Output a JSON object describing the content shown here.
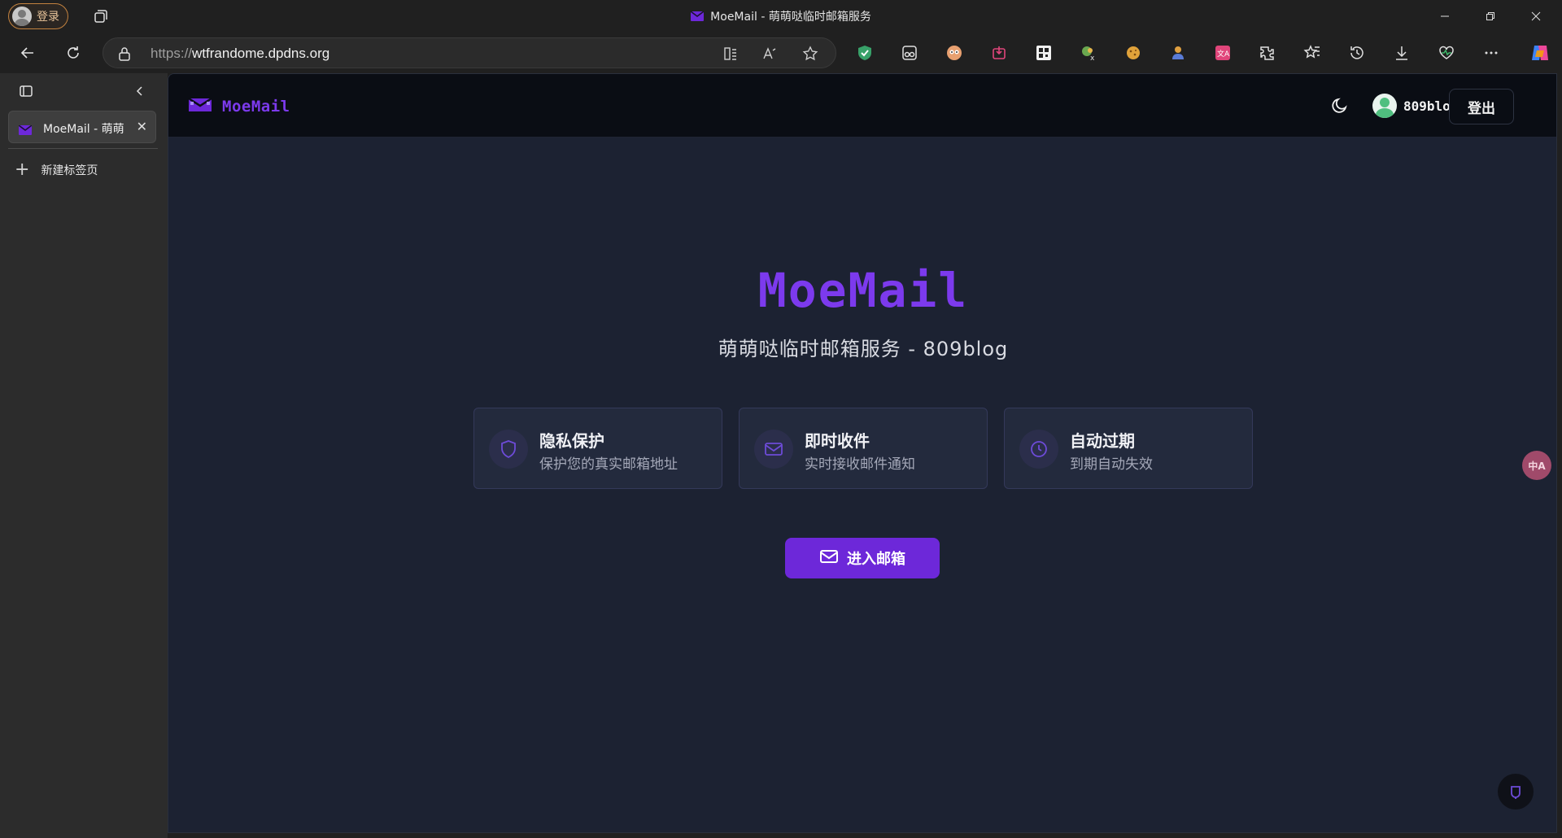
{
  "browser": {
    "profile_label": "登录",
    "window_title": "MoeMail - 萌萌哒临时邮箱服务",
    "url_scheme": "https://",
    "url_host": "wtfrandome.dpdns.org",
    "icons": [
      "tab-actions-icon",
      "back-icon",
      "refresh-icon",
      "lock-icon",
      "reader-mode-icon",
      "read-aloud-icon",
      "favorite-star-icon",
      "shield-extension-icon",
      "glasses-extension-icon",
      "face-extension-icon",
      "download-extension-icon",
      "qr-extension-icon",
      "xiaohongshu-extension-icon",
      "cookie-extension-icon",
      "person-extension-icon",
      "translate-extension-icon",
      "extensions-icon",
      "favorites-icon",
      "history-icon",
      "downloads-icon",
      "health-icon",
      "more-icon",
      "copilot-icon"
    ]
  },
  "sidebar": {
    "tab_label": "MoeMail - 萌萌",
    "new_tab_label": "新建标签页"
  },
  "site": {
    "logo_text": "MoeMail",
    "username": "809blog",
    "logout_label": "登出",
    "hero_title": "MoeMail",
    "hero_subtitle": "萌萌哒临时邮箱服务 - 809blog",
    "features": [
      {
        "title": "隐私保护",
        "desc": "保护您的真实邮箱地址",
        "icon": "shield-icon"
      },
      {
        "title": "即时收件",
        "desc": "实时接收邮件通知",
        "icon": "mail-icon"
      },
      {
        "title": "自动过期",
        "desc": "到期自动失效",
        "icon": "clock-icon"
      }
    ],
    "enter_label": "进入邮箱",
    "translate_fab": "中A"
  },
  "colors": {
    "accent": "#7c3aed",
    "button": "#6d28d9",
    "page_bg": "#1c2232",
    "header_bg": "#0a0d14",
    "card_bg": "#232a3d"
  }
}
